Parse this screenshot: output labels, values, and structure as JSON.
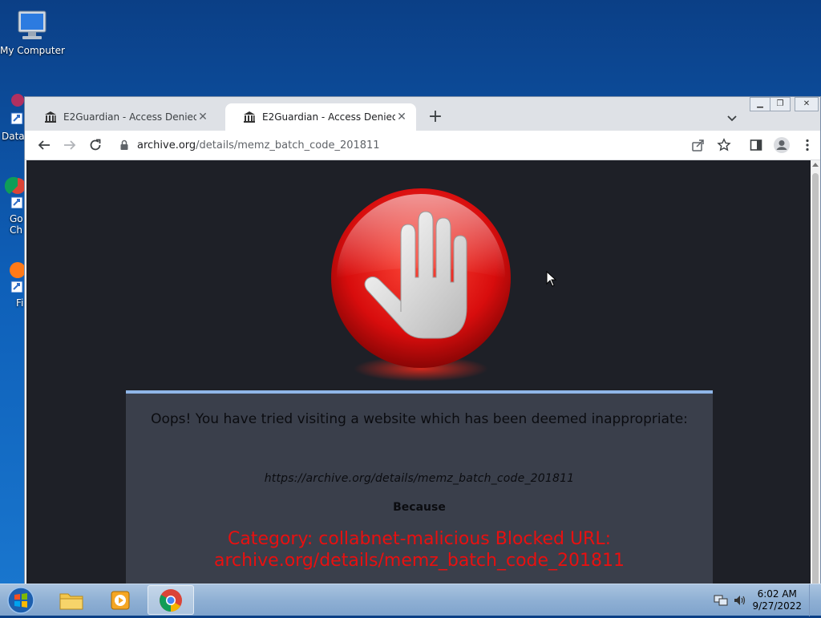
{
  "desktop": {
    "icons": [
      {
        "label": "My Computer"
      },
      {
        "label": "Data"
      },
      {
        "label": "Go Ch"
      },
      {
        "label": "Fi"
      }
    ]
  },
  "browser": {
    "tabs": [
      {
        "title": "E2Guardian - Access Denied",
        "active": false
      },
      {
        "title": "E2Guardian - Access Denied",
        "active": true
      }
    ],
    "new_tab_symbol": "+",
    "address": {
      "host": "archive.org",
      "path": "/details/memz_batch_code_201811"
    },
    "window_controls": [
      "minimize",
      "restore",
      "close"
    ]
  },
  "page": {
    "heading": "Oops! You have tried visiting a website which has been deemed inappropriate:",
    "blocked_url": "https://archive.org/details/memz_batch_code_201811",
    "because_label": "Because",
    "reason": "Category: collabnet-malicious  Blocked URL: archive.org/details/memz_batch_code_201811",
    "colors": {
      "background": "#1e2027",
      "box": "#3a3f4b",
      "reason": "#e81010",
      "accent": "#8fb6e8"
    }
  },
  "taskbar": {
    "apps": [
      {
        "name": "file-explorer-icon"
      },
      {
        "name": "media-player-icon"
      },
      {
        "name": "chrome-icon",
        "active": true
      }
    ],
    "clock": {
      "time": "6:02 AM",
      "date": "9/27/2022"
    }
  }
}
